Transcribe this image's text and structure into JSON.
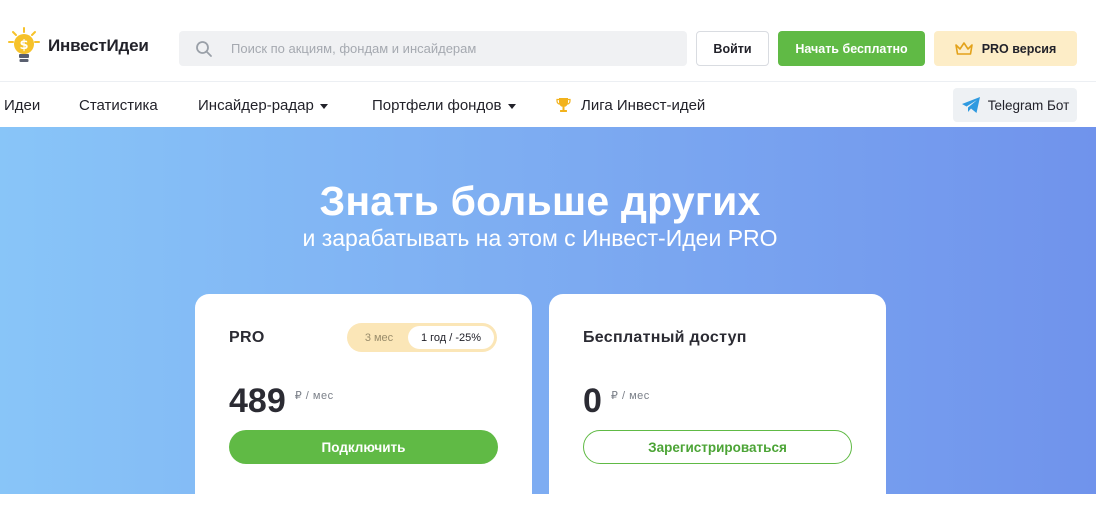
{
  "header": {
    "logo_text": "ИнвестИдеи",
    "search_placeholder": "Поиск по акциям, фондам и инсайдерам",
    "login_label": "Войти",
    "start_label": "Начать бесплатно",
    "pro_label": "PRO версия"
  },
  "nav": {
    "items": [
      {
        "label": "Идеи"
      },
      {
        "label": "Статистика"
      },
      {
        "label": "Инсайдер-радар",
        "dropdown": true
      },
      {
        "label": "Портфели фондов",
        "dropdown": true
      },
      {
        "label": "Лига Инвест-идей",
        "icon": "trophy-icon"
      }
    ],
    "telegram_label": "Telegram Бот"
  },
  "hero": {
    "title": "Знать больше других",
    "subtitle": "и зарабатывать на этом с Инвест-Идеи PRO"
  },
  "plans": {
    "pro": {
      "title": "PRO",
      "toggle_month": "3 мес",
      "toggle_year": "1 год / -25%",
      "toggle_selected": "1 год / -25%",
      "price": "489",
      "unit": "₽ / мес",
      "cta": "Подключить"
    },
    "free": {
      "title": "Бесплатный доступ",
      "price": "0",
      "unit": "₽ / мес",
      "cta": "Зарегистрироваться"
    }
  },
  "colors": {
    "brand_green": "#60ba45",
    "pro_bg": "#fdedc7",
    "hero_gradient_start": "#88c5f8",
    "hero_gradient_end": "#7093ec"
  }
}
